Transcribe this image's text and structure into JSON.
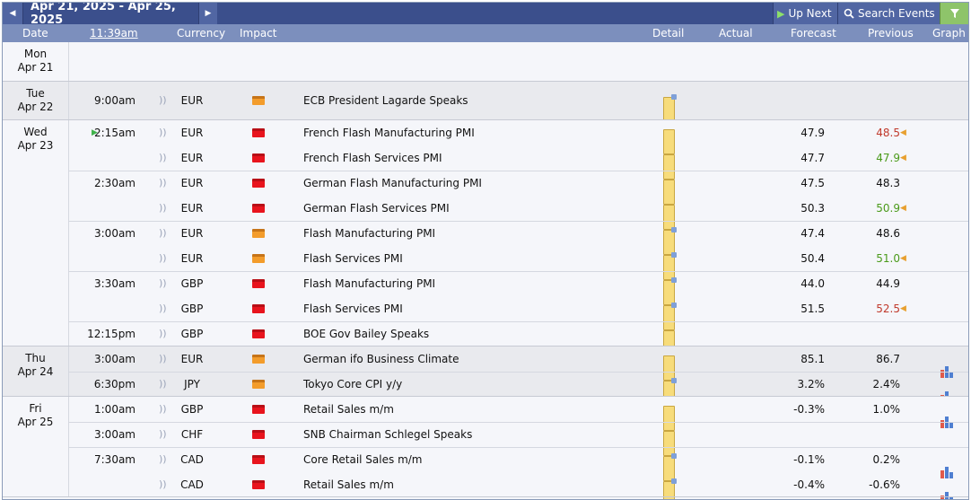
{
  "toolbar": {
    "prev_label": "◀",
    "date_range": "Apr 21, 2025 - Apr 25, 2025",
    "next_label": "▶",
    "up_next": "Up Next",
    "search_events": "Search Events",
    "filter_label": "▼"
  },
  "header": {
    "date": "Date",
    "time": "11:39am",
    "currency": "Currency",
    "impact": "Impact",
    "detail": "Detail",
    "actual": "Actual",
    "forecast": "Forecast",
    "previous": "Previous",
    "graph": "Graph"
  },
  "days": [
    {
      "dow": "Mon",
      "date": "Apr 21"
    },
    {
      "dow": "Tue",
      "date": "Apr 22"
    },
    {
      "dow": "Wed",
      "date": "Apr 23"
    },
    {
      "dow": "Thu",
      "date": "Apr 24"
    },
    {
      "dow": "Fri",
      "date": "Apr 25"
    }
  ],
  "events": [
    {
      "time": "9:00am",
      "currency": "EUR",
      "impact": "medium",
      "event": "ECB President Lagarde Speaks",
      "forecast": "",
      "previous": "",
      "previous_color": "",
      "graph": false
    },
    {
      "time": "2:15am",
      "currency": "EUR",
      "impact": "high",
      "event": "French Flash Manufacturing PMI",
      "forecast": "47.9",
      "previous": "48.5",
      "previous_color": "red",
      "graph": false
    },
    {
      "time": "",
      "currency": "EUR",
      "impact": "high",
      "event": "French Flash Services PMI",
      "forecast": "47.7",
      "previous": "47.9",
      "previous_color": "green",
      "graph": false
    },
    {
      "time": "2:30am",
      "currency": "EUR",
      "impact": "high",
      "event": "German Flash Manufacturing PMI",
      "forecast": "47.5",
      "previous": "48.3",
      "previous_color": "",
      "graph": false
    },
    {
      "time": "",
      "currency": "EUR",
      "impact": "high",
      "event": "German Flash Services PMI",
      "forecast": "50.3",
      "previous": "50.9",
      "previous_color": "green",
      "graph": false
    },
    {
      "time": "3:00am",
      "currency": "EUR",
      "impact": "medium",
      "event": "Flash Manufacturing PMI",
      "forecast": "47.4",
      "previous": "48.6",
      "previous_color": "",
      "graph": false
    },
    {
      "time": "",
      "currency": "EUR",
      "impact": "medium",
      "event": "Flash Services PMI",
      "forecast": "50.4",
      "previous": "51.0",
      "previous_color": "green",
      "graph": false
    },
    {
      "time": "3:30am",
      "currency": "GBP",
      "impact": "high",
      "event": "Flash Manufacturing PMI",
      "forecast": "44.0",
      "previous": "44.9",
      "previous_color": "",
      "graph": false
    },
    {
      "time": "",
      "currency": "GBP",
      "impact": "high",
      "event": "Flash Services PMI",
      "forecast": "51.5",
      "previous": "52.5",
      "previous_color": "red",
      "graph": false
    },
    {
      "time": "12:15pm",
      "currency": "GBP",
      "impact": "high",
      "event": "BOE Gov Bailey Speaks",
      "forecast": "",
      "previous": "",
      "previous_color": "",
      "graph": false
    },
    {
      "time": "3:00am",
      "currency": "EUR",
      "impact": "medium",
      "event": "German ifo Business Climate",
      "forecast": "85.1",
      "previous": "86.7",
      "previous_color": "",
      "graph": true
    },
    {
      "time": "6:30pm",
      "currency": "JPY",
      "impact": "medium",
      "event": "Tokyo Core CPI y/y",
      "forecast": "3.2%",
      "previous": "2.4%",
      "previous_color": "",
      "graph": true
    },
    {
      "time": "1:00am",
      "currency": "GBP",
      "impact": "high",
      "event": "Retail Sales m/m",
      "forecast": "-0.3%",
      "previous": "1.0%",
      "previous_color": "",
      "graph": true
    },
    {
      "time": "3:00am",
      "currency": "CHF",
      "impact": "high",
      "event": "SNB Chairman Schlegel Speaks",
      "forecast": "",
      "previous": "",
      "previous_color": "",
      "graph": false
    },
    {
      "time": "7:30am",
      "currency": "CAD",
      "impact": "high",
      "event": "Core Retail Sales m/m",
      "forecast": "-0.1%",
      "previous": "0.2%",
      "previous_color": "",
      "graph": true
    },
    {
      "time": "",
      "currency": "CAD",
      "impact": "high",
      "event": "Retail Sales m/m",
      "forecast": "-0.4%",
      "previous": "-0.6%",
      "previous_color": "",
      "graph": true
    }
  ],
  "colors": {
    "high_impact": "#e8141d",
    "medium_impact": "#f39c2b",
    "header_bg": "#3b4f8c",
    "filter_bg": "#8ec46a"
  }
}
